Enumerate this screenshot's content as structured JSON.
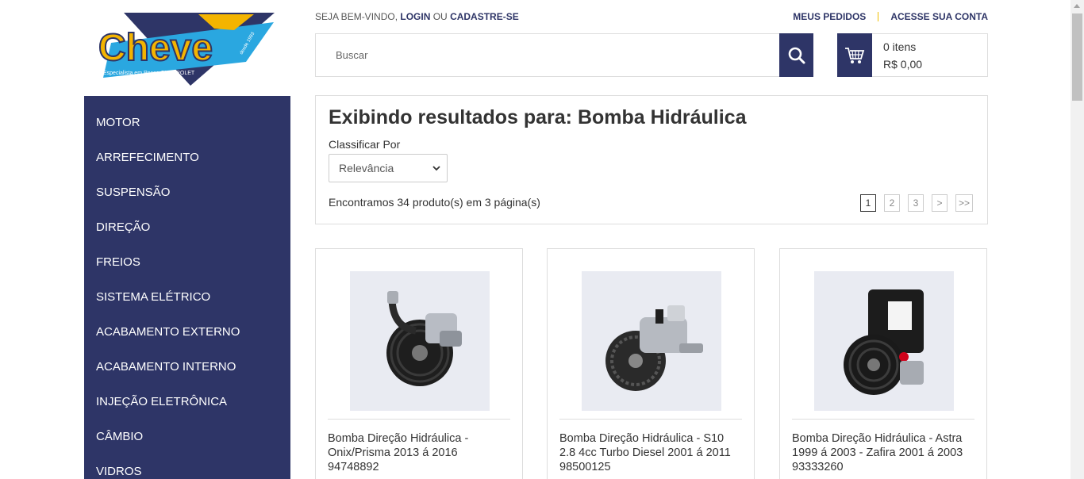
{
  "logo": {
    "text": "Cheve",
    "tagline": "Especialista em Peças CHEVROLET",
    "badge": "desde 1993"
  },
  "header": {
    "welcome_prefix": "SEJA BEM-VINDO,",
    "login": "LOGIN",
    "or": "OU",
    "register": "CADASTRE-SE",
    "my_orders": "MEUS PEDIDOS",
    "account": "ACESSE SUA CONTA"
  },
  "search": {
    "placeholder": "Buscar",
    "icon": "search-icon"
  },
  "cart": {
    "items": "0 itens",
    "total": "R$ 0,00",
    "icon": "cart-icon"
  },
  "sidebar": {
    "items": [
      {
        "label": "MOTOR"
      },
      {
        "label": "ARREFECIMENTO"
      },
      {
        "label": "SUSPENSÃO"
      },
      {
        "label": "DIREÇÃO"
      },
      {
        "label": "FREIOS"
      },
      {
        "label": "SISTEMA ELÉTRICO"
      },
      {
        "label": "ACABAMENTO EXTERNO"
      },
      {
        "label": "ACABAMENTO INTERNO"
      },
      {
        "label": "INJEÇÃO ELETRÔNICA"
      },
      {
        "label": "CÂMBIO"
      },
      {
        "label": "VIDROS"
      }
    ]
  },
  "results": {
    "heading": "Exibindo resultados para: Bomba Hidráulica",
    "sort_label": "Classificar Por",
    "sort_value": "Relevância",
    "found": "Encontramos 34 produto(s) em 3 página(s)",
    "pages": [
      "1",
      "2",
      "3",
      ">",
      ">>"
    ],
    "active_page": "1"
  },
  "products": [
    {
      "title": "Bomba Direção Hidráulica - Onix/Prisma 2013 á 2016 94748892"
    },
    {
      "title": "Bomba Direção Hidráulica - S10 2.8 4cc Turbo Diesel 2001 á 2011 98500125"
    },
    {
      "title": "Bomba Direção Hidráulica - Astra 1999 á 2003 - Zafira 2001 á 2003 93333260"
    }
  ],
  "colors": {
    "brand_navy": "#2e3567",
    "accent_yellow": "#f0c000"
  }
}
